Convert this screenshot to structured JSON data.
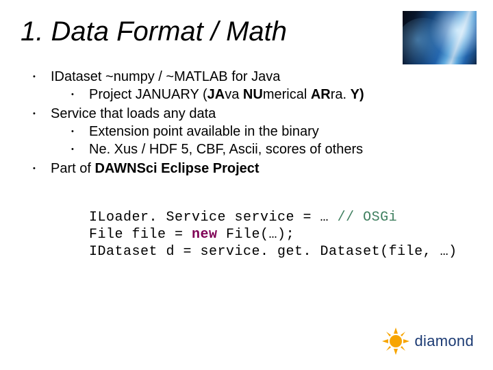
{
  "title": {
    "num": "1.",
    "text": "Data Format / Math"
  },
  "bullets": {
    "b1": "IDataset ~numpy / ~MATLAB for Java",
    "b1_1_pre": "Project JANUARY (",
    "b1_1_bold": "JA",
    "b1_1_mid1": "va ",
    "b1_1_bold2": "NU",
    "b1_1_mid2": "merical ",
    "b1_1_bold3": "AR",
    "b1_1_mid3": "ra. ",
    "b1_1_bold4": "Y)",
    "b2": "Service that loads any data",
    "b2_1": "Extension point available in the binary",
    "b2_2": "Ne. Xus / HDF 5, CBF, Ascii, scores of others",
    "b3_pre": "Part of ",
    "b3_bold": "DAWNSci Eclipse Project"
  },
  "code": {
    "l1a": "ILoader. Service service = … ",
    "l1b": "// OSGi",
    "l2a": "File file = ",
    "l2kw": "new",
    "l2b": " File(…);",
    "l3": "IDataset d = service. get. Dataset(file, …)"
  },
  "logo": {
    "text": "diamond"
  }
}
